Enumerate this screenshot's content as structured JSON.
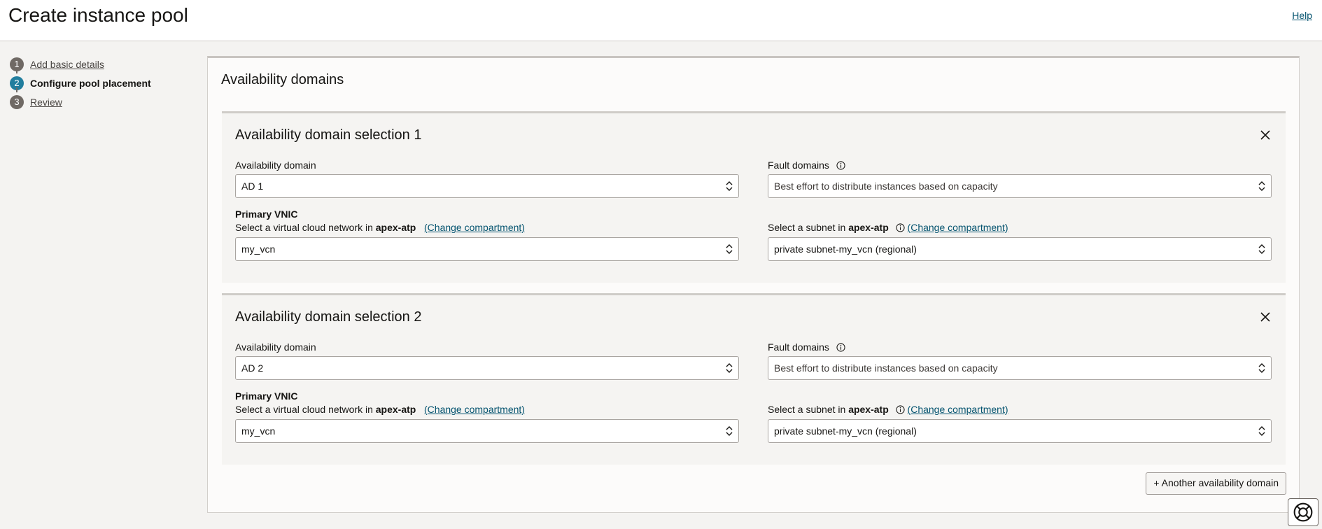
{
  "header": {
    "title": "Create instance pool",
    "help_label": "Help"
  },
  "steps": [
    {
      "num": "1",
      "label": "Add basic details",
      "active": false
    },
    {
      "num": "2",
      "label": "Configure pool placement",
      "active": true
    },
    {
      "num": "3",
      "label": "Review",
      "active": false
    }
  ],
  "section": {
    "title": "Availability domains"
  },
  "labels": {
    "availability_domain": "Availability domain",
    "fault_domains": "Fault domains",
    "primary_vnic": "Primary VNIC",
    "vcn_prefix": "Select a virtual cloud network in",
    "subnet_prefix": "Select a subnet in",
    "compartment": "apex-atp",
    "change_compartment": "(Change compartment)"
  },
  "ad_selections": [
    {
      "title": "Availability domain selection 1",
      "availability_domain": "AD 1",
      "fault_domains": "Best effort to distribute instances based on capacity",
      "vcn": "my_vcn",
      "subnet": "private subnet-my_vcn (regional)"
    },
    {
      "title": "Availability domain selection 2",
      "availability_domain": "AD 2",
      "fault_domains": "Best effort to distribute instances based on capacity",
      "vcn": "my_vcn",
      "subnet": "private subnet-my_vcn (regional)"
    }
  ],
  "add_button_label": "+ Another availability domain",
  "icons": [
    "close-icon",
    "info-icon",
    "chevron-updown-icon",
    "lifebuoy-icon"
  ]
}
